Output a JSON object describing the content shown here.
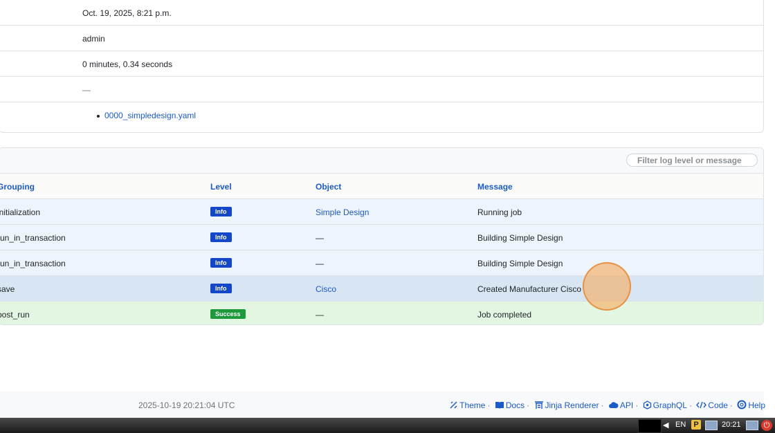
{
  "details": {
    "created": "Oct. 19, 2025, 8:21 p.m.",
    "user": "admin",
    "duration": "0 minutes, 0.34 seconds",
    "data": "—",
    "file_link": "0000_simpledesign.yaml"
  },
  "log": {
    "filter_placeholder": "Filter log level or message",
    "columns": [
      "Grouping",
      "Level",
      "Object",
      "Message"
    ],
    "rows": [
      {
        "grouping": "initialization",
        "level": "Info",
        "object": "Simple Design",
        "message": "Running job"
      },
      {
        "grouping": "run_in_transaction",
        "level": "Info",
        "object": "—",
        "message": "Building Simple Design"
      },
      {
        "grouping": "run_in_transaction",
        "level": "Info",
        "object": "—",
        "message": "Building Simple Design"
      },
      {
        "grouping": "save",
        "level": "Info",
        "object": "Cisco",
        "message": "Created Manufacturer Cisco"
      },
      {
        "grouping": "post_run",
        "level": "Success",
        "object": "—",
        "message": "Job completed"
      }
    ]
  },
  "footer": {
    "timestamp": "2025-10-19 20:21:04 UTC",
    "links": [
      "Theme",
      "Docs",
      "Jinja Renderer",
      "API",
      "GraphQL",
      "Code",
      "Help"
    ],
    "separator": "·"
  },
  "taskbar": {
    "lang": "EN",
    "p_label": "P",
    "time": "20:21"
  },
  "colors": {
    "link": "#1c5ac6",
    "info_badge": "#1346c8",
    "success_badge": "#1e9a3c",
    "info_row": "#eef4fb",
    "success_row": "#e2f6e2"
  }
}
